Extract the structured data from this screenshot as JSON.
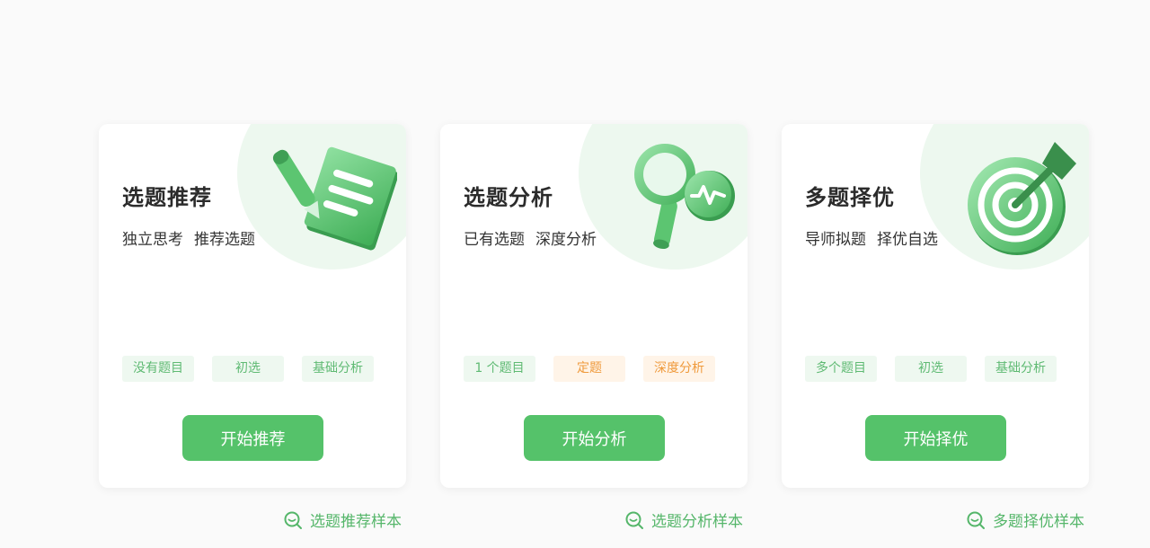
{
  "colors": {
    "primary": "#55c26a",
    "tag_green_text": "#5fba73",
    "tag_green_bg": "#eef8f0",
    "tag_orange_text": "#ef9a3c",
    "tag_orange_bg": "#fff4e8",
    "circle_bg": "#edf8ef"
  },
  "cards": [
    {
      "title": "选题推荐",
      "subtitle": [
        "独立思考",
        "推荐选题"
      ],
      "tags": [
        {
          "label": "没有题目",
          "color": "green"
        },
        {
          "label": "初选",
          "color": "green"
        },
        {
          "label": "基础分析",
          "color": "green"
        }
      ],
      "button": "开始推荐",
      "sample_link": "选题推荐样本",
      "icon": "notepad-pen-icon"
    },
    {
      "title": "选题分析",
      "subtitle": [
        "已有选题",
        "深度分析"
      ],
      "tags": [
        {
          "label": "1 个题目",
          "color": "green"
        },
        {
          "label": "定题",
          "color": "orange"
        },
        {
          "label": "深度分析",
          "color": "orange"
        }
      ],
      "button": "开始分析",
      "sample_link": "选题分析样本",
      "icon": "magnifier-pulse-icon"
    },
    {
      "title": "多题择优",
      "subtitle": [
        "导师拟题",
        "择优自选"
      ],
      "tags": [
        {
          "label": "多个题目",
          "color": "green"
        },
        {
          "label": "初选",
          "color": "green"
        },
        {
          "label": "基础分析",
          "color": "green"
        }
      ],
      "button": "开始择优",
      "sample_link": "多题择优样本",
      "icon": "target-dart-icon"
    }
  ]
}
